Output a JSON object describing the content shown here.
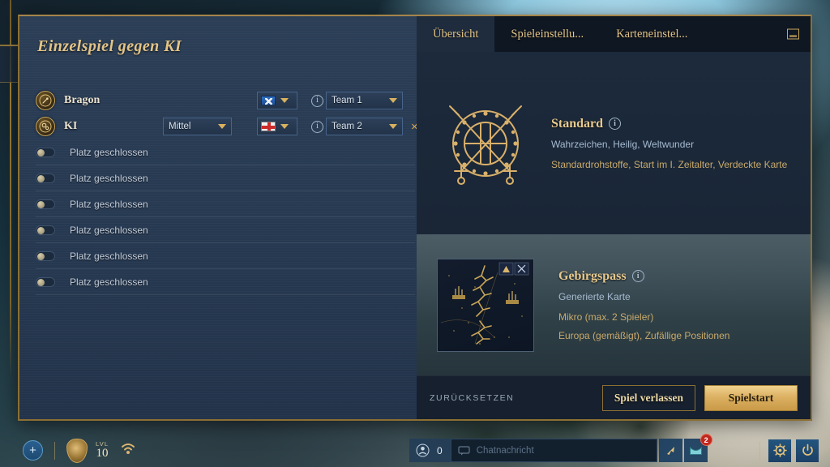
{
  "window": {
    "title": "Einzelspiel gegen KI"
  },
  "players": [
    {
      "name": "Bragon",
      "avatar_icon": "feather-crest-icon",
      "difficulty": null,
      "flag": "flag-fr",
      "flag_icon": "flag-france-icon",
      "info_icon": "info-icon",
      "team": "Team 1",
      "closable": false
    },
    {
      "name": "KI",
      "avatar_icon": "gear-crest-icon",
      "difficulty": "Mittel",
      "flag": "flag-en",
      "flag_icon": "flag-england-icon",
      "info_icon": "info-icon",
      "team": "Team 2",
      "closable": true,
      "close_label": "×"
    }
  ],
  "closed_slots": [
    {
      "label": "Platz geschlossen",
      "enabled": false
    },
    {
      "label": "Platz geschlossen",
      "enabled": false
    },
    {
      "label": "Platz geschlossen",
      "enabled": false
    },
    {
      "label": "Platz geschlossen",
      "enabled": false
    },
    {
      "label": "Platz geschlossen",
      "enabled": false
    },
    {
      "label": "Platz geschlossen",
      "enabled": false
    }
  ],
  "tabs": [
    {
      "label": "Übersicht",
      "active": true
    },
    {
      "label": "Spieleinstellu...",
      "active": false
    },
    {
      "label": "Karteneinstel...",
      "active": false
    }
  ],
  "minimize_icon": "minimize-icon",
  "gamemode": {
    "emblem_icon": "crossed-swords-shield-icon",
    "title": "Standard",
    "info_icon": "info-icon",
    "line_a": "Wahrzeichen, Heilig, Weltwunder",
    "line_b": "Standardrohstoffe, Start im I. Zeitalter, Verdeckte Karte"
  },
  "map": {
    "thumb_icon": "map-preview-icon",
    "title": "Gebirgspass",
    "info_icon": "info-icon",
    "line_a": "Generierte Karte",
    "line_b": "Mikro (max. 2 Spieler)",
    "line_c": "Europa (gemäßigt), Zufällige Positionen"
  },
  "footer": {
    "reset_label": "ZURÜCKSETZEN",
    "leave_label": "Spiel verlassen",
    "start_label": "Spielstart"
  },
  "taskbar": {
    "add_label": "+",
    "add_icon": "plus-icon",
    "crest_icon": "lion-crest-icon",
    "level_caption": "LVL",
    "level_value": "10",
    "wifi_icon": "wifi-icon",
    "friends_icon": "person-icon",
    "friends_count": "0",
    "chat_icon": "chat-bubble-icon",
    "chat_placeholder": "Chatnachricht",
    "send_icon": "cursor-send-icon",
    "mail_icon": "mail-icon",
    "mail_badge": "2",
    "settings_icon": "gear-icon",
    "power_icon": "power-icon"
  },
  "colors": {
    "gold": "#c9a45e",
    "panel_blue": "#273a52",
    "tab_dark": "#0f1722",
    "accent_button": "#dcb163",
    "badge_red": "#c0281f"
  }
}
